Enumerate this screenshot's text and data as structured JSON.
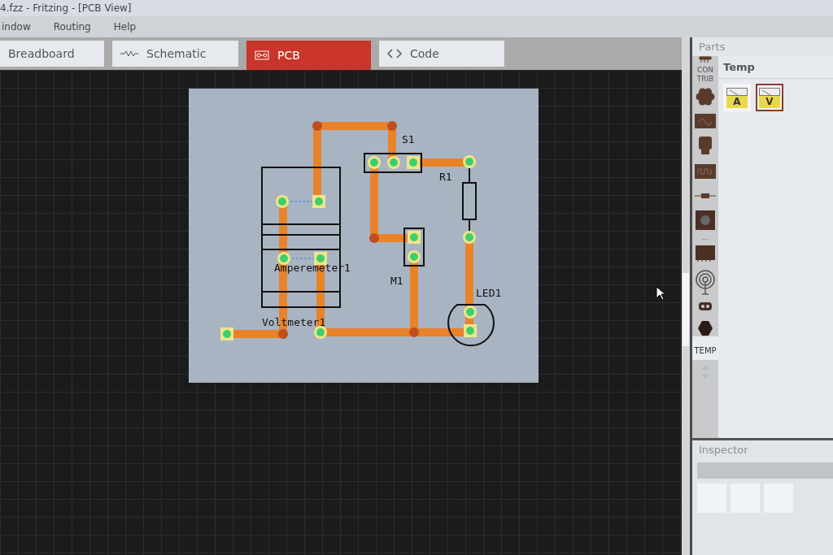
{
  "window": {
    "title": "4.fzz - Fritzing - [PCB View]"
  },
  "menu": [
    "indow",
    "Routing",
    "Help"
  ],
  "tabs": [
    {
      "label": "Breadboard",
      "kind": "breadboard",
      "selected": false
    },
    {
      "label": "Schematic",
      "kind": "schematic",
      "selected": false
    },
    {
      "label": "PCB",
      "kind": "pcb",
      "selected": true
    },
    {
      "label": "Code",
      "kind": "code",
      "selected": false
    }
  ],
  "pcb": {
    "labels": [
      "S1",
      "R1",
      "Amperemeter1",
      "M1",
      "LED1",
      "Voltmeter1"
    ]
  },
  "parts": {
    "title": "Parts",
    "bin_title": "Temp",
    "items": [
      {
        "label": "A",
        "selected": false
      },
      {
        "label": "V",
        "selected": true
      }
    ],
    "bins": {
      "contrib": "CON TRIB",
      "more": "...",
      "temp": {
        "label": "TEMP",
        "selected": true
      }
    }
  },
  "inspector": {
    "title": "Inspector"
  }
}
